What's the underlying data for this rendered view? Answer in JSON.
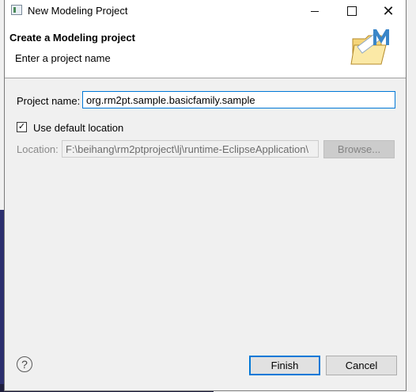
{
  "window": {
    "title": "New Modeling Project"
  },
  "header": {
    "title": "Create a Modeling project",
    "message": "Enter a project name",
    "icon": "folder-with-M-icon"
  },
  "form": {
    "project_name_label": "Project name:",
    "project_name_value": "org.rm2pt.sample.basicfamily.sample",
    "use_default_label": "Use default location",
    "use_default_checked": true,
    "location_label": "Location:",
    "location_value": "F:\\beihang\\rm2ptproject\\lj\\runtime-EclipseApplication\\",
    "browse_label": "Browse..."
  },
  "buttons": {
    "finish": "Finish",
    "cancel": "Cancel",
    "help": "?"
  },
  "colors": {
    "focus_border": "#0078d7",
    "dialog_bg": "#f0f0f0"
  }
}
